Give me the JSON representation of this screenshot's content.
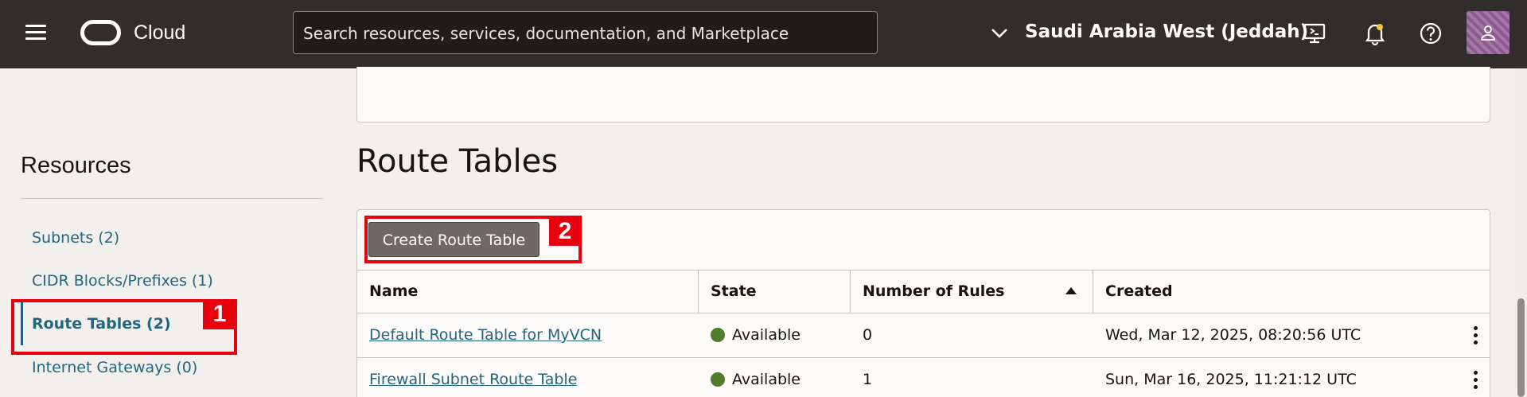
{
  "header": {
    "brand": "Cloud",
    "search_placeholder": "Search resources, services, documentation, and Marketplace",
    "region": "Saudi Arabia West (Jeddah)"
  },
  "resources": {
    "title": "Resources",
    "items": [
      {
        "label": "Subnets (2)"
      },
      {
        "label": "CIDR Blocks/Prefixes (1)"
      },
      {
        "label": "Route Tables (2)"
      },
      {
        "label": "Internet Gateways (0)"
      }
    ]
  },
  "main": {
    "heading": "Route Tables",
    "create_button": "Create Route Table",
    "columns": [
      "Name",
      "State",
      "Number of Rules",
      "Created"
    ],
    "rows": [
      {
        "name": "Default Route Table for MyVCN",
        "state": "Available",
        "rules": "0",
        "created": "Wed, Mar 12, 2025, 08:20:56 UTC"
      },
      {
        "name": "Firewall Subnet Route Table",
        "state": "Available",
        "rules": "1",
        "created": "Sun, Mar 16, 2025, 11:21:12 UTC"
      }
    ]
  },
  "callouts": {
    "one": "1",
    "two": "2"
  },
  "colors": {
    "accent": "#23657d",
    "callout": "#e8000f",
    "available": "#4f7d2a",
    "header": "#312d2a"
  }
}
